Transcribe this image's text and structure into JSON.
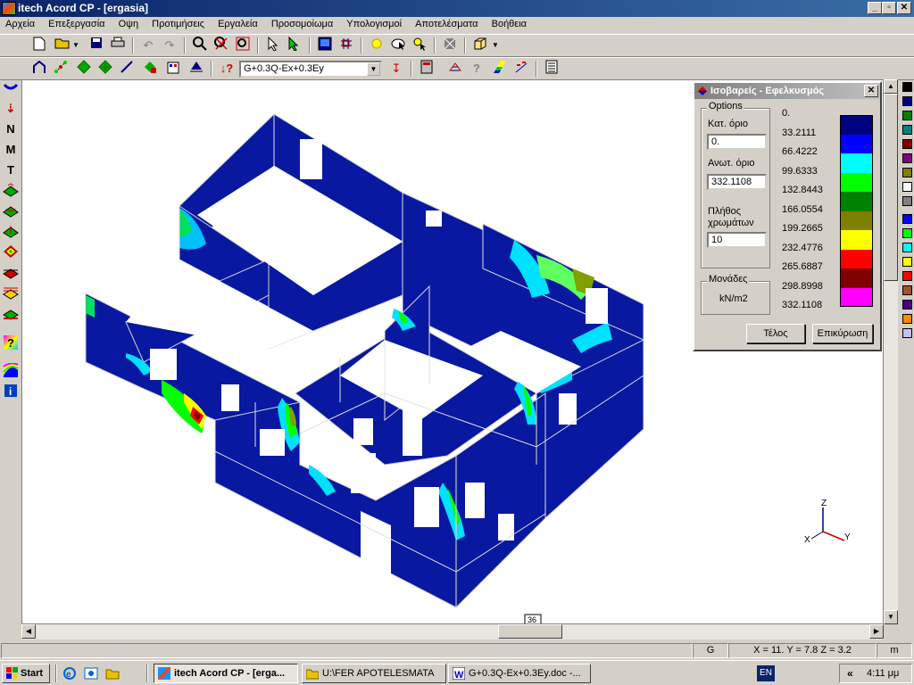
{
  "window": {
    "title": "itech Acord CP - [ergasia]",
    "minimize_glyph": "_",
    "restore_glyph": "▫",
    "close_glyph": "✕"
  },
  "menu": [
    "Αρχεία",
    "Επεξεργασία",
    "Οψη",
    "Προτιμήσεις",
    "Εργαλεία",
    "Προσομοίωμα",
    "Υπολογισμοί",
    "Αποτελέσματα",
    "Βοήθεια"
  ],
  "toolbar1_icons": [
    "new-file-icon",
    "open-folder-icon",
    "save-icon",
    "print-icon",
    "undo-icon",
    "redo-icon",
    "zoom-icon",
    "zoom-window-icon",
    "zoom-extents-icon",
    "select-arrow-icon",
    "select-cursor-icon",
    "monitor-icon",
    "grid-select-icon",
    "light-icon",
    "light-cursor-icon",
    "pointer-cursor-icon",
    "shade-icon",
    "box-3d-icon"
  ],
  "toolbar2": {
    "combo_value": "G+0.3Q-Ex+0.3Ey"
  },
  "left_tools": [
    "deformed-icon",
    "load-arrow-icon",
    "N",
    "M",
    "T",
    "layer-1-icon",
    "layer-2-icon",
    "layer-3-icon",
    "layer-4-icon",
    "layer-5-icon",
    "layer-6-icon",
    "layer-7-icon",
    "query-icon",
    "contour-icon",
    "info-icon"
  ],
  "dialog": {
    "title": "Ισοβαρείς - Εφελκυσμός",
    "options_caption": "Options",
    "lower_label": "Κατ. όριο",
    "lower_value": "0.",
    "upper_label": "Ανωτ. όριο",
    "upper_value": "332.1108",
    "count_label_1": "Πλήθος",
    "count_label_2": "χρωμάτων",
    "count_value": "10",
    "units_caption": "Μονάδες",
    "units_value": "kN/m2",
    "close_button": "Τέλος",
    "apply_button": "Επικύρωση",
    "legend_values": [
      "0.",
      "33.2111",
      "66.4222",
      "99.6333",
      "132.8443",
      "166.0554",
      "199.2665",
      "232.4776",
      "265.6887",
      "298.8998",
      "332.1108"
    ],
    "legend_colors": [
      "#000080",
      "#0000ff",
      "#00ffff",
      "#00ff00",
      "#008000",
      "#808000",
      "#ffff00",
      "#ff0000",
      "#800000",
      "#ff00ff"
    ]
  },
  "palette_colors": [
    "#000000",
    "#000080",
    "#008000",
    "#008080",
    "#800000",
    "#800080",
    "#808000",
    "#ffffff",
    "#808080",
    "#0000ff",
    "#00ff00",
    "#00ffff",
    "#ffff00",
    "#ff0000",
    "#a0522d",
    "#4b0082",
    "#ff8c00",
    "#c0c0ff"
  ],
  "axes": {
    "z": "Z",
    "x": "X",
    "y": "Y"
  },
  "viewport_marker": "36",
  "status": {
    "g": "G",
    "coords": "X = 11.  Y = 7.8  Z = 3.2",
    "units": "m"
  },
  "taskbar": {
    "start": "Start",
    "tasks": [
      "itech Acord CP - [erga...",
      "U:\\FER APOTELESMATA",
      "G+0.3Q-Ex+0.3Ey.doc -..."
    ],
    "lang": "EN",
    "chevron": "«",
    "clock": "4:11 μμ"
  }
}
